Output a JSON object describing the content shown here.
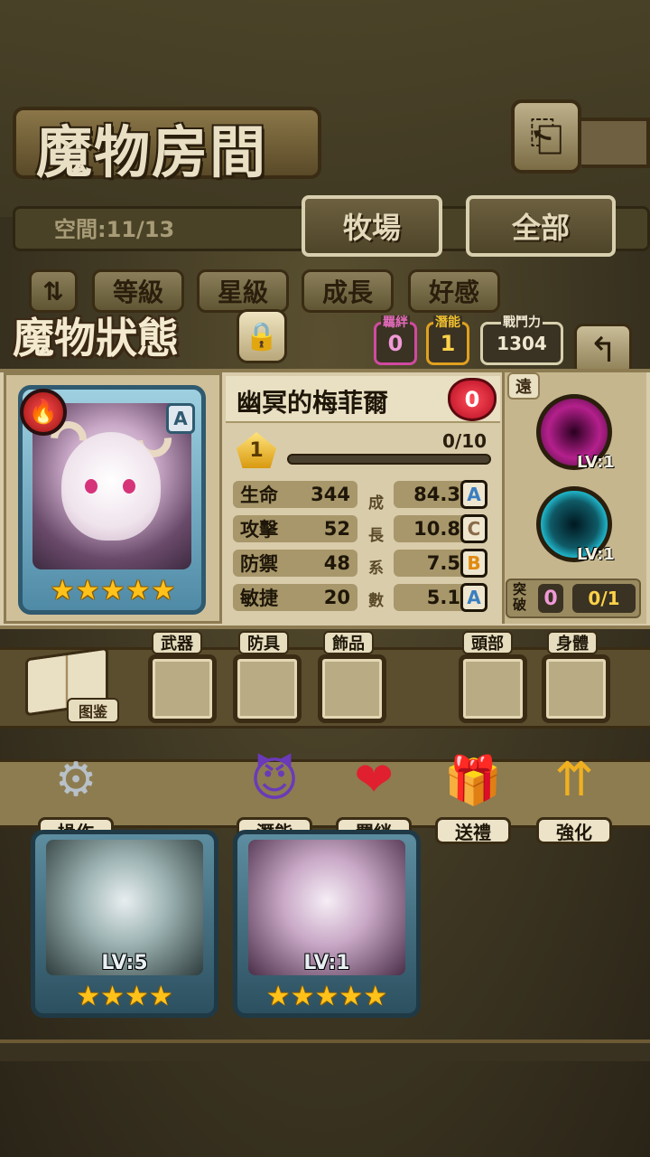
{
  "header": {
    "title": "魔物房間",
    "back_icon": "return-arrow-icon"
  },
  "tabs": {
    "space_label": "空間:11/13",
    "items": [
      {
        "label": "牧場"
      },
      {
        "label": "全部"
      }
    ]
  },
  "sort": {
    "items": [
      {
        "label": "等級"
      },
      {
        "label": "星級"
      },
      {
        "label": "成長"
      },
      {
        "label": "好感"
      }
    ]
  },
  "status": {
    "title": "魔物狀態",
    "bond_label": "羈絆",
    "bond_value": "0",
    "potential_label": "潛能",
    "potential_value": "1",
    "power_label": "戰鬥力",
    "power_value": "1304"
  },
  "monster": {
    "name": "幽冥的梅菲爾",
    "affection": "0",
    "rank": "A",
    "star_count": 5,
    "level_badge": "1",
    "exp_text": "0/10",
    "exp_fraction": 0.0,
    "element_color": "#e0312f",
    "stats": [
      {
        "label": "生命",
        "value": "344",
        "growth": "84.3",
        "grade": "A",
        "grade_color": "#3a7fc1"
      },
      {
        "label": "攻擊",
        "value": "52",
        "growth": "10.8",
        "grade": "C",
        "grade_color": "#8a6a4a"
      },
      {
        "label": "防禦",
        "value": "48",
        "growth": "7.5",
        "grade": "B",
        "grade_color": "#e08a10"
      },
      {
        "label": "敏捷",
        "value": "20",
        "growth": "5.1",
        "grade": "A",
        "grade_color": "#3a7fc1"
      }
    ],
    "growth_chars": [
      "成",
      "長",
      "系",
      "數"
    ]
  },
  "skills": {
    "range_tag": "遠",
    "items": [
      {
        "level": "LV:1",
        "color": "#b4208c"
      },
      {
        "level": "LV:1",
        "color": "#1fb4c8"
      }
    ],
    "break_label": "突破",
    "break_value": "0",
    "break_progress": "0/1"
  },
  "equipment": {
    "book_label": "图鉴",
    "slots": [
      {
        "label": "武器"
      },
      {
        "label": "防具"
      },
      {
        "label": "飾品"
      },
      {
        "label": "頭部"
      },
      {
        "label": "身體"
      }
    ]
  },
  "actions": [
    {
      "label": "操作",
      "icon": "gear-icon"
    },
    {
      "label": "潛能",
      "icon": "demon-icon"
    },
    {
      "label": "羈絆",
      "icon": "hearts-icon"
    },
    {
      "label": "送禮",
      "icon": "gift-icon"
    },
    {
      "label": "強化",
      "icon": "upgrade-arrows-icon"
    }
  ],
  "roster": [
    {
      "level": "LV:5",
      "stars": "★★★★"
    },
    {
      "level": "LV:1",
      "stars": "★★★★★"
    }
  ]
}
